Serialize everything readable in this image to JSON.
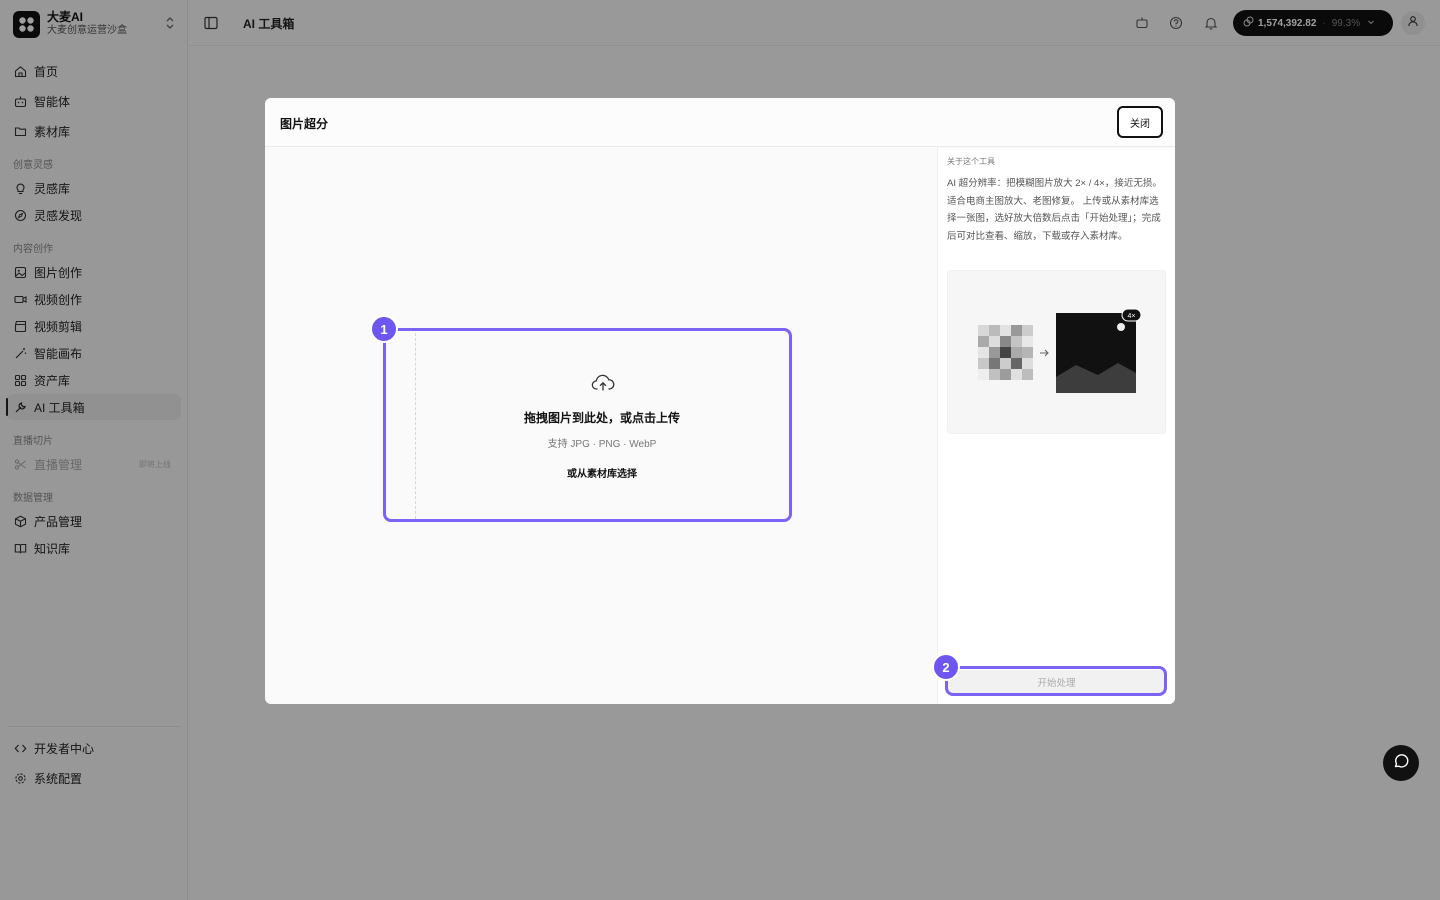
{
  "app": {
    "name": "大麦AI",
    "workspace": "大麦创意运营沙盒"
  },
  "sidebar": {
    "top_items": [
      {
        "label": "首页",
        "icon": "home-icon"
      },
      {
        "label": "智能体",
        "icon": "bot-icon"
      },
      {
        "label": "素材库",
        "icon": "folder-icon"
      }
    ],
    "sections": [
      {
        "label": "创意灵感",
        "items": [
          {
            "label": "灵感库",
            "icon": "lightbulb-icon"
          },
          {
            "label": "灵感发现",
            "icon": "compass-icon"
          }
        ]
      },
      {
        "label": "内容创作",
        "items": [
          {
            "label": "图片创作",
            "icon": "image-icon"
          },
          {
            "label": "视频创作",
            "icon": "video-icon"
          },
          {
            "label": "视频剪辑",
            "icon": "clapper-icon"
          },
          {
            "label": "智能画布",
            "icon": "magic-wand-icon"
          },
          {
            "label": "资产库",
            "icon": "grid-icon"
          },
          {
            "label": "AI 工具箱",
            "icon": "wrench-icon",
            "active": true
          }
        ]
      },
      {
        "label": "直播切片",
        "items": [
          {
            "label": "直播管理",
            "icon": "scissors-icon",
            "disabled": true,
            "tag": "即将上线"
          }
        ]
      },
      {
        "label": "数据管理",
        "items": [
          {
            "label": "产品管理",
            "icon": "box-icon"
          },
          {
            "label": "知识库",
            "icon": "book-icon"
          }
        ]
      }
    ],
    "bottom_items": [
      {
        "label": "开发者中心",
        "icon": "code-icon"
      },
      {
        "label": "系统配置",
        "icon": "gear-icon"
      }
    ]
  },
  "header": {
    "breadcrumb": "AI 工具箱",
    "credits": "1,574,392.82",
    "credits_percent": "99.3%"
  },
  "modal": {
    "title": "图片超分",
    "close_label": "关闭",
    "upload": {
      "title": "拖拽图片到此处，或点击上传",
      "formats": "支持 JPG · PNG · WebP",
      "library_link": "或从素材库选择"
    },
    "about": {
      "label": "关于这个工具",
      "text": "AI 超分辨率：把模糊图片放大 2× / 4×，接近无损。适合电商主图放大、老图修复。 上传或从素材库选择一张图，选好放大倍数后点击「开始处理」；完成后可对比查看、缩放，下载或存入素材库。",
      "preview_badge": "4×"
    },
    "start_label": "开始处理",
    "steps": [
      "1",
      "2"
    ]
  },
  "colors": {
    "accent": "#7a63f5",
    "badge": "#6e56f0",
    "dark": "#111111"
  }
}
